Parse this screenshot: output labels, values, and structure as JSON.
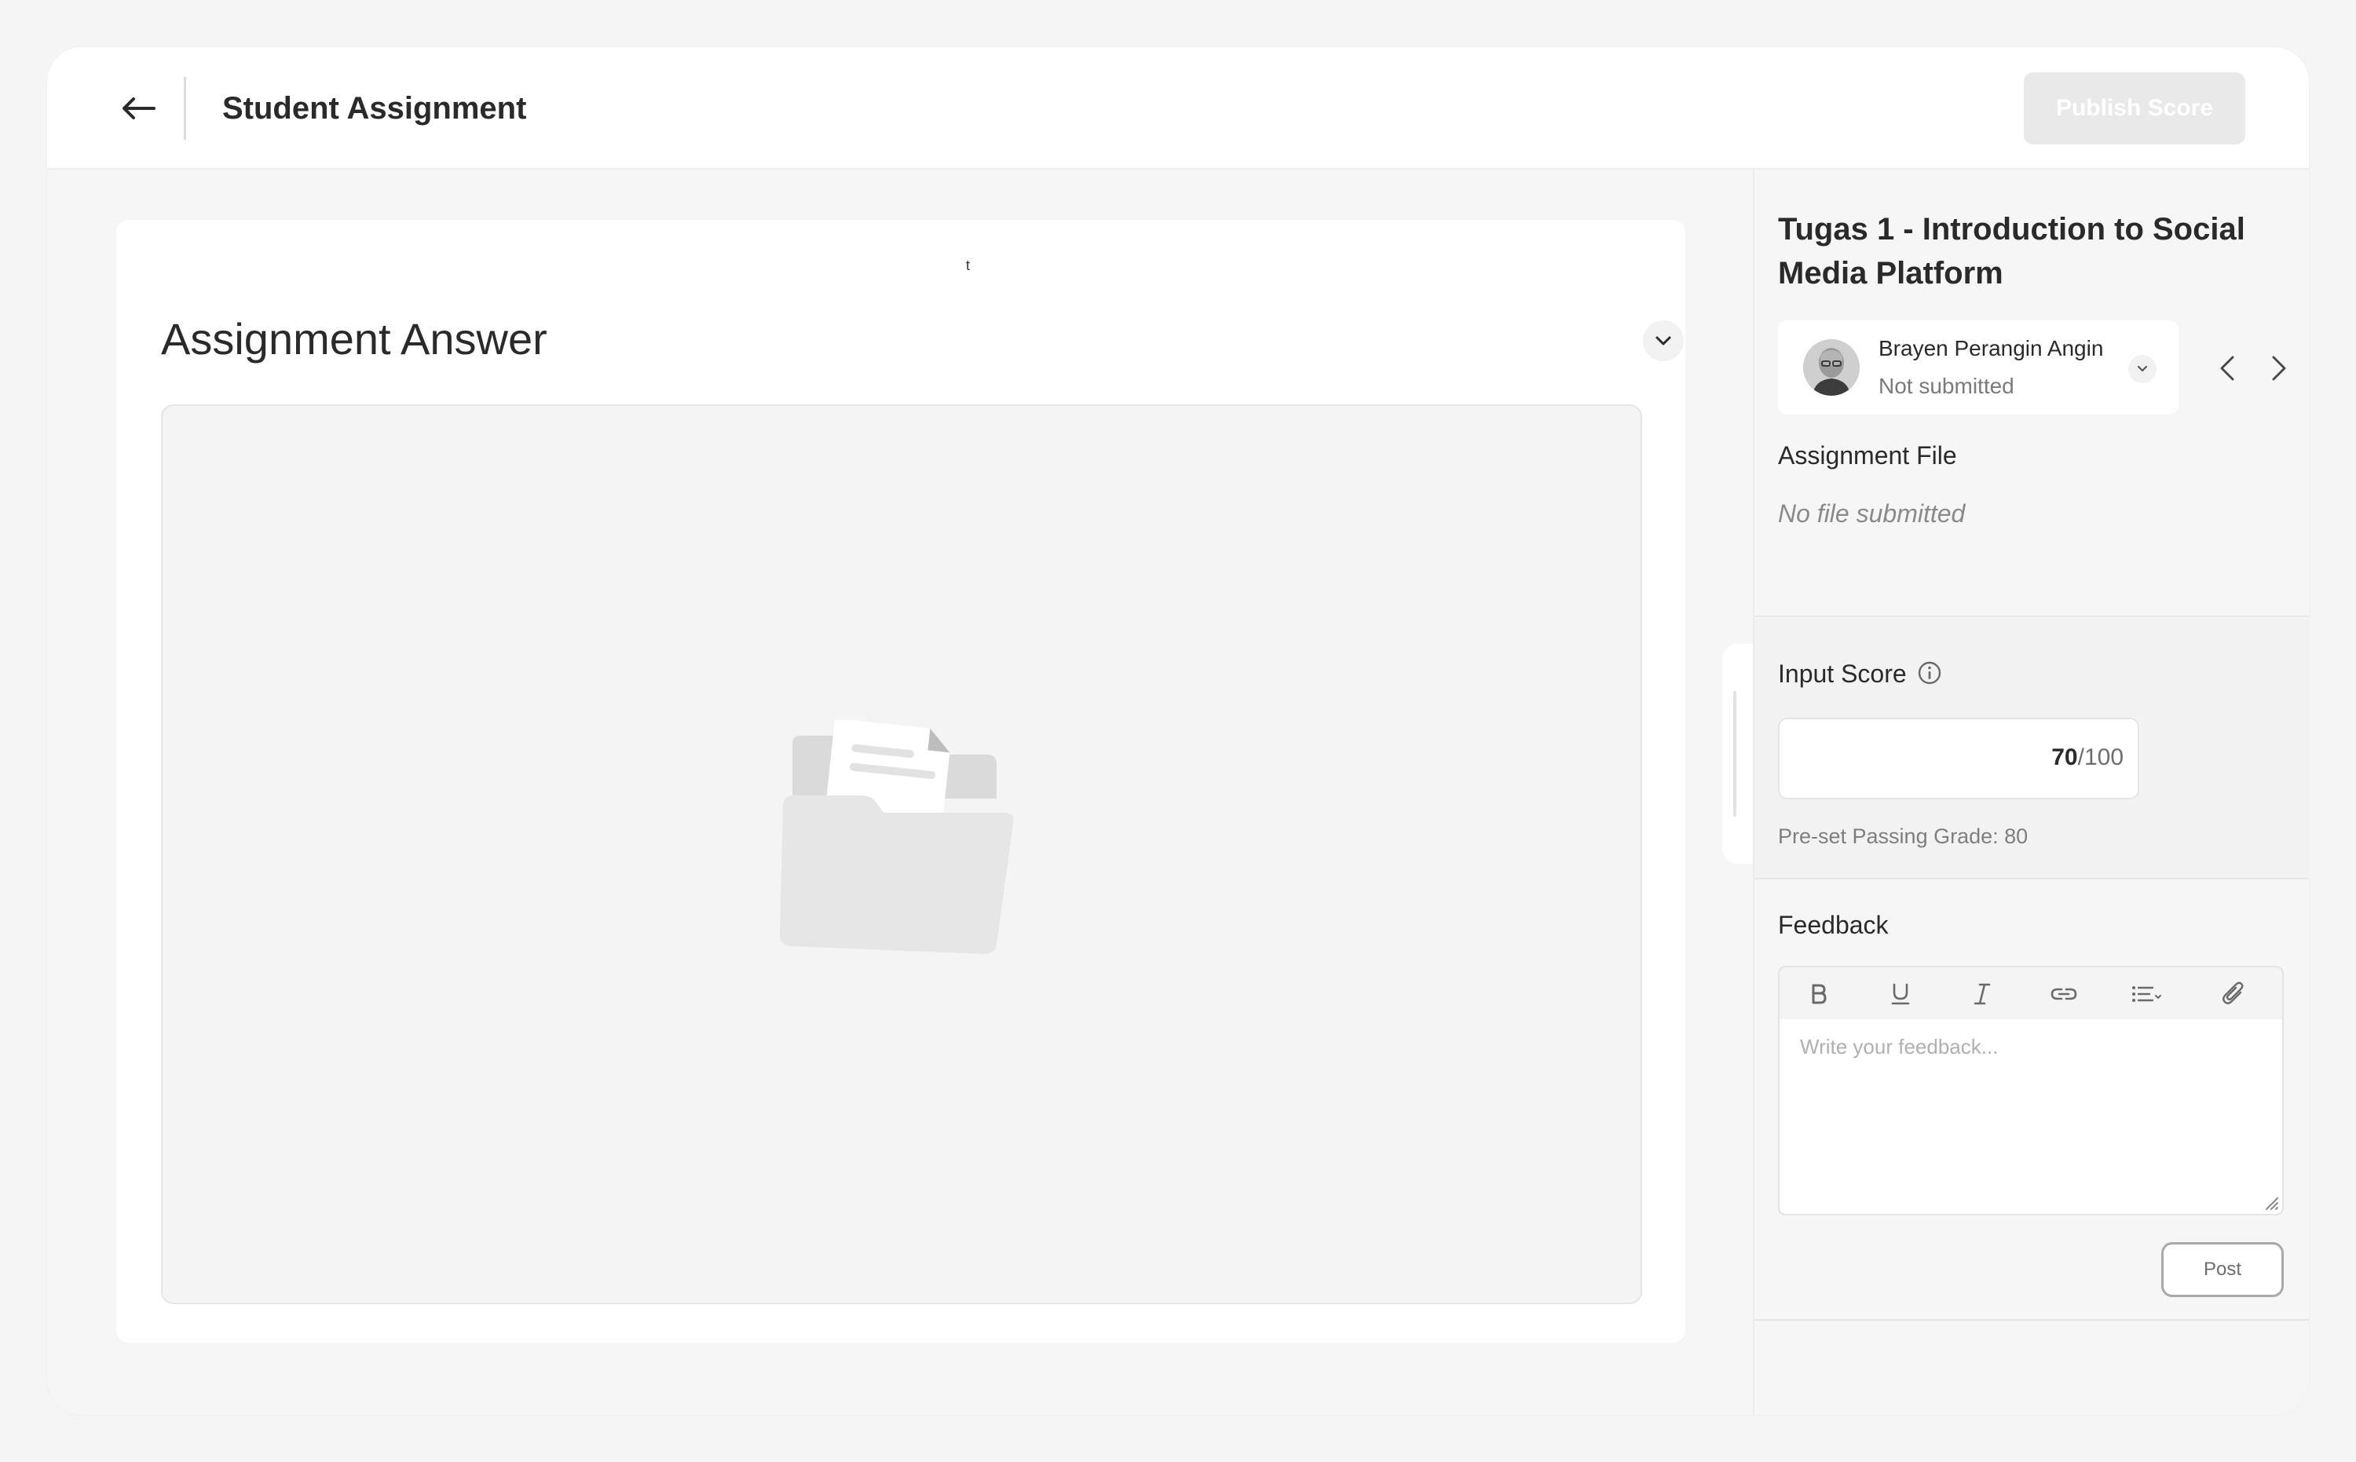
{
  "header": {
    "title": "Student Assignment",
    "publish_label": "Publish Score"
  },
  "answer": {
    "stray_text": "t",
    "title": "Assignment Answer"
  },
  "panel": {
    "assignment_title": "Tugas 1 - Introduction to Social Media Platform",
    "student": {
      "name": "Brayen Perangin Angin",
      "status": "Not submitted"
    },
    "file_section": {
      "label": "Assignment File",
      "empty_text": "No file submitted"
    },
    "score": {
      "label": "Input Score",
      "value": "70",
      "max": "/100",
      "passing_text": "Pre-set Passing Grade: 80"
    },
    "feedback": {
      "label": "Feedback",
      "placeholder": "Write your feedback...",
      "post_label": "Post",
      "toolbar": [
        "bold-icon",
        "underline-icon",
        "italic-icon",
        "link-icon",
        "list-icon",
        "attach-icon"
      ]
    }
  },
  "colors": {
    "publish_disabled_bg": "#e9e9e9",
    "panel_bg": "#f6f6f6",
    "text": "#2a2a2a",
    "muted": "#8a8a8a"
  }
}
